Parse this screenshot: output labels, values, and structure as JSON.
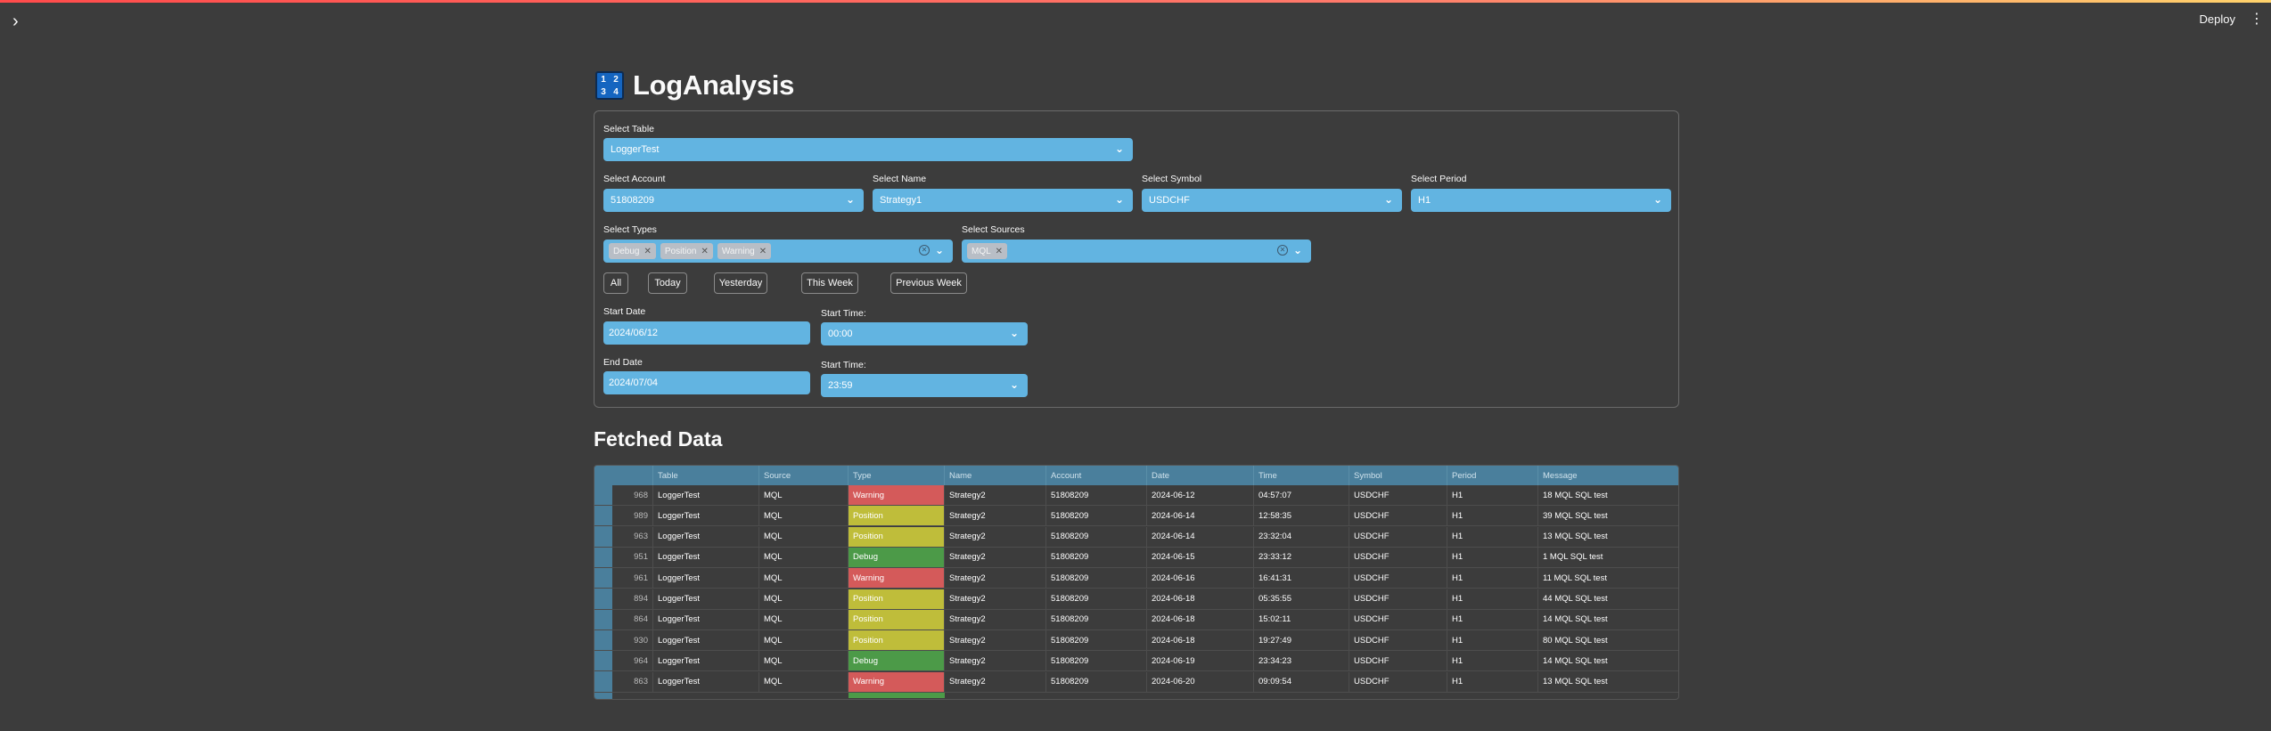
{
  "header": {
    "sidebar_toggle_icon": "chevron-right-icon",
    "deploy_label": "Deploy",
    "menu_icon": "kebab-menu-icon"
  },
  "title": {
    "icon": "numbers-1234-icon",
    "icon_digits": [
      "1",
      "2",
      "3",
      "4"
    ],
    "text": "LogAnalysis"
  },
  "filters": {
    "table": {
      "label": "Select Table",
      "value": "LoggerTest"
    },
    "account": {
      "label": "Select Account",
      "value": "51808209"
    },
    "name": {
      "label": "Select Name",
      "value": "Strategy1"
    },
    "symbol": {
      "label": "Select Symbol",
      "value": "USDCHF"
    },
    "period": {
      "label": "Select Period",
      "value": "H1"
    },
    "types": {
      "label": "Select Types",
      "tags": [
        "Debug",
        "Position",
        "Warning"
      ]
    },
    "sources": {
      "label": "Select Sources",
      "tags": [
        "MQL"
      ]
    },
    "quick_buttons": [
      "All",
      "Today",
      "Yesterday",
      "This Week",
      "Previous Week"
    ],
    "start_date": {
      "label": "Start Date",
      "value": "2024/06/12"
    },
    "start_time": {
      "label": "Start Time:",
      "value": "00:00"
    },
    "end_date": {
      "label": "End Date",
      "value": "2024/07/04"
    },
    "end_time": {
      "label": "Start Time:",
      "value": "23:59"
    }
  },
  "fetched": {
    "title": "Fetched Data",
    "columns": [
      "",
      "Table",
      "Source",
      "Type",
      "Name",
      "Account",
      "Date",
      "Time",
      "Symbol",
      "Period",
      "Message"
    ],
    "rows": [
      [
        "968",
        "LoggerTest",
        "MQL",
        "Warning",
        "Strategy2",
        "51808209",
        "2024-06-12",
        "04:57:07",
        "USDCHF",
        "H1",
        "18 MQL SQL test"
      ],
      [
        "989",
        "LoggerTest",
        "MQL",
        "Position",
        "Strategy2",
        "51808209",
        "2024-06-14",
        "12:58:35",
        "USDCHF",
        "H1",
        "39 MQL SQL test"
      ],
      [
        "963",
        "LoggerTest",
        "MQL",
        "Position",
        "Strategy2",
        "51808209",
        "2024-06-14",
        "23:32:04",
        "USDCHF",
        "H1",
        "13 MQL SQL test"
      ],
      [
        "951",
        "LoggerTest",
        "MQL",
        "Debug",
        "Strategy2",
        "51808209",
        "2024-06-15",
        "23:33:12",
        "USDCHF",
        "H1",
        "1 MQL SQL test"
      ],
      [
        "961",
        "LoggerTest",
        "MQL",
        "Warning",
        "Strategy2",
        "51808209",
        "2024-06-16",
        "16:41:31",
        "USDCHF",
        "H1",
        "11 MQL SQL test"
      ],
      [
        "894",
        "LoggerTest",
        "MQL",
        "Position",
        "Strategy2",
        "51808209",
        "2024-06-18",
        "05:35:55",
        "USDCHF",
        "H1",
        "44 MQL SQL test"
      ],
      [
        "864",
        "LoggerTest",
        "MQL",
        "Position",
        "Strategy2",
        "51808209",
        "2024-06-18",
        "15:02:11",
        "USDCHF",
        "H1",
        "14 MQL SQL test"
      ],
      [
        "930",
        "LoggerTest",
        "MQL",
        "Position",
        "Strategy2",
        "51808209",
        "2024-06-18",
        "19:27:49",
        "USDCHF",
        "H1",
        "80 MQL SQL test"
      ],
      [
        "964",
        "LoggerTest",
        "MQL",
        "Debug",
        "Strategy2",
        "51808209",
        "2024-06-19",
        "23:34:23",
        "USDCHF",
        "H1",
        "14 MQL SQL test"
      ],
      [
        "863",
        "LoggerTest",
        "MQL",
        "Warning",
        "Strategy2",
        "51808209",
        "2024-06-20",
        "09:09:54",
        "USDCHF",
        "H1",
        "13 MQL SQL test"
      ]
    ],
    "type_colors": {
      "Warning": "#d45a5a",
      "Position": "#bfbd3a",
      "Debug": "#4c9a48"
    }
  },
  "colors": {
    "background": "#3c3c3c",
    "select_fill": "#62b4e1",
    "header_fill": "#4a7f9c",
    "accent_bar": "#ff4b4b"
  }
}
